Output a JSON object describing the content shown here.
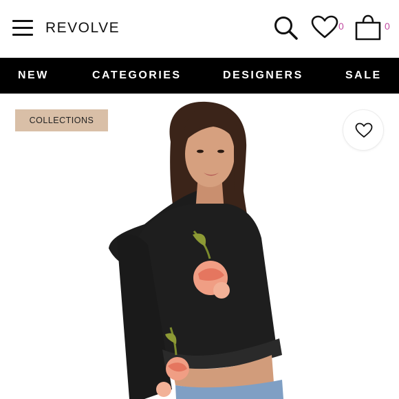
{
  "header": {
    "logo": "REVOLVE",
    "wishlist_count": "0",
    "bag_count": "0",
    "icons": [
      "menu-icon",
      "search-icon",
      "heart-icon",
      "shopping-bag-icon"
    ],
    "count_color": "#c14aa0"
  },
  "nav": {
    "items": [
      "NEW",
      "CATEGORIES",
      "DESIGNERS",
      "SALE"
    ]
  },
  "product": {
    "badge": "COLLECTIONS",
    "badge_color": "#d9bfa7",
    "favorite_icon": "heart-outline-icon",
    "image": "model-wearing-black-cropped-hoodie-with-floral-embroidery"
  }
}
